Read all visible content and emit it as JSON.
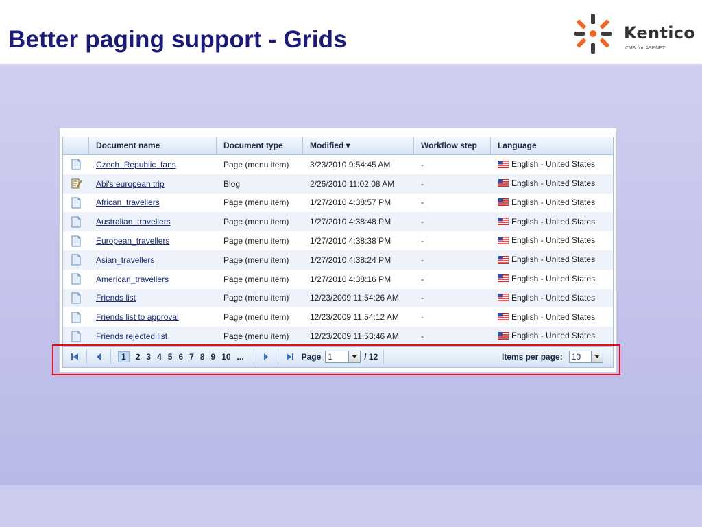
{
  "slide": {
    "title": "Better paging support - Grids"
  },
  "logo": {
    "name": "Kentico",
    "tagline": "CMS for ASP.NET"
  },
  "grid": {
    "columns": [
      "Document name",
      "Document type",
      "Modified",
      "Workflow step",
      "Language"
    ],
    "sort_indicator": "▾",
    "rows": [
      {
        "icon": "page",
        "name": "Czech_Republic_fans",
        "type": "Page (menu item)",
        "modified": "3/23/2010 9:54:45 AM",
        "workflow": "-",
        "language": "English - United States"
      },
      {
        "icon": "blog",
        "name": "Abi's european trip",
        "type": "Blog",
        "modified": "2/26/2010 11:02:08 AM",
        "workflow": "-",
        "language": "English - United States"
      },
      {
        "icon": "page",
        "name": "African_travellers",
        "type": "Page (menu item)",
        "modified": "1/27/2010 4:38:57 PM",
        "workflow": "-",
        "language": "English - United States"
      },
      {
        "icon": "page",
        "name": "Australian_travellers",
        "type": "Page (menu item)",
        "modified": "1/27/2010 4:38:48 PM",
        "workflow": "-",
        "language": "English - United States"
      },
      {
        "icon": "page",
        "name": "European_travellers",
        "type": "Page (menu item)",
        "modified": "1/27/2010 4:38:38 PM",
        "workflow": "-",
        "language": "English - United States"
      },
      {
        "icon": "page",
        "name": "Asian_travellers",
        "type": "Page (menu item)",
        "modified": "1/27/2010 4:38:24 PM",
        "workflow": "-",
        "language": "English - United States"
      },
      {
        "icon": "page",
        "name": "American_travellers",
        "type": "Page (menu item)",
        "modified": "1/27/2010 4:38:16 PM",
        "workflow": "-",
        "language": "English - United States"
      },
      {
        "icon": "page",
        "name": "Friends list",
        "type": "Page (menu item)",
        "modified": "12/23/2009 11:54:26 AM",
        "workflow": "-",
        "language": "English - United States"
      },
      {
        "icon": "page",
        "name": "Friends list to approval",
        "type": "Page (menu item)",
        "modified": "12/23/2009 11:54:12 AM",
        "workflow": "-",
        "language": "English - United States"
      },
      {
        "icon": "page",
        "name": "Friends rejected list",
        "type": "Page (menu item)",
        "modified": "12/23/2009 11:53:46 AM",
        "workflow": "-",
        "language": "English - United States"
      }
    ]
  },
  "pager": {
    "pages": [
      "1",
      "2",
      "3",
      "4",
      "5",
      "6",
      "7",
      "8",
      "9",
      "10",
      "..."
    ],
    "current_page": "1",
    "page_label": "Page",
    "page_value": "1",
    "total_pages": "/ 12",
    "items_per_page_label": "Items per page:",
    "items_per_page_value": "10"
  },
  "colors": {
    "title": "#1a1a7a",
    "highlight": "#e0101a",
    "link": "#1a2a7a",
    "grid_border": "#a9c3e3"
  }
}
